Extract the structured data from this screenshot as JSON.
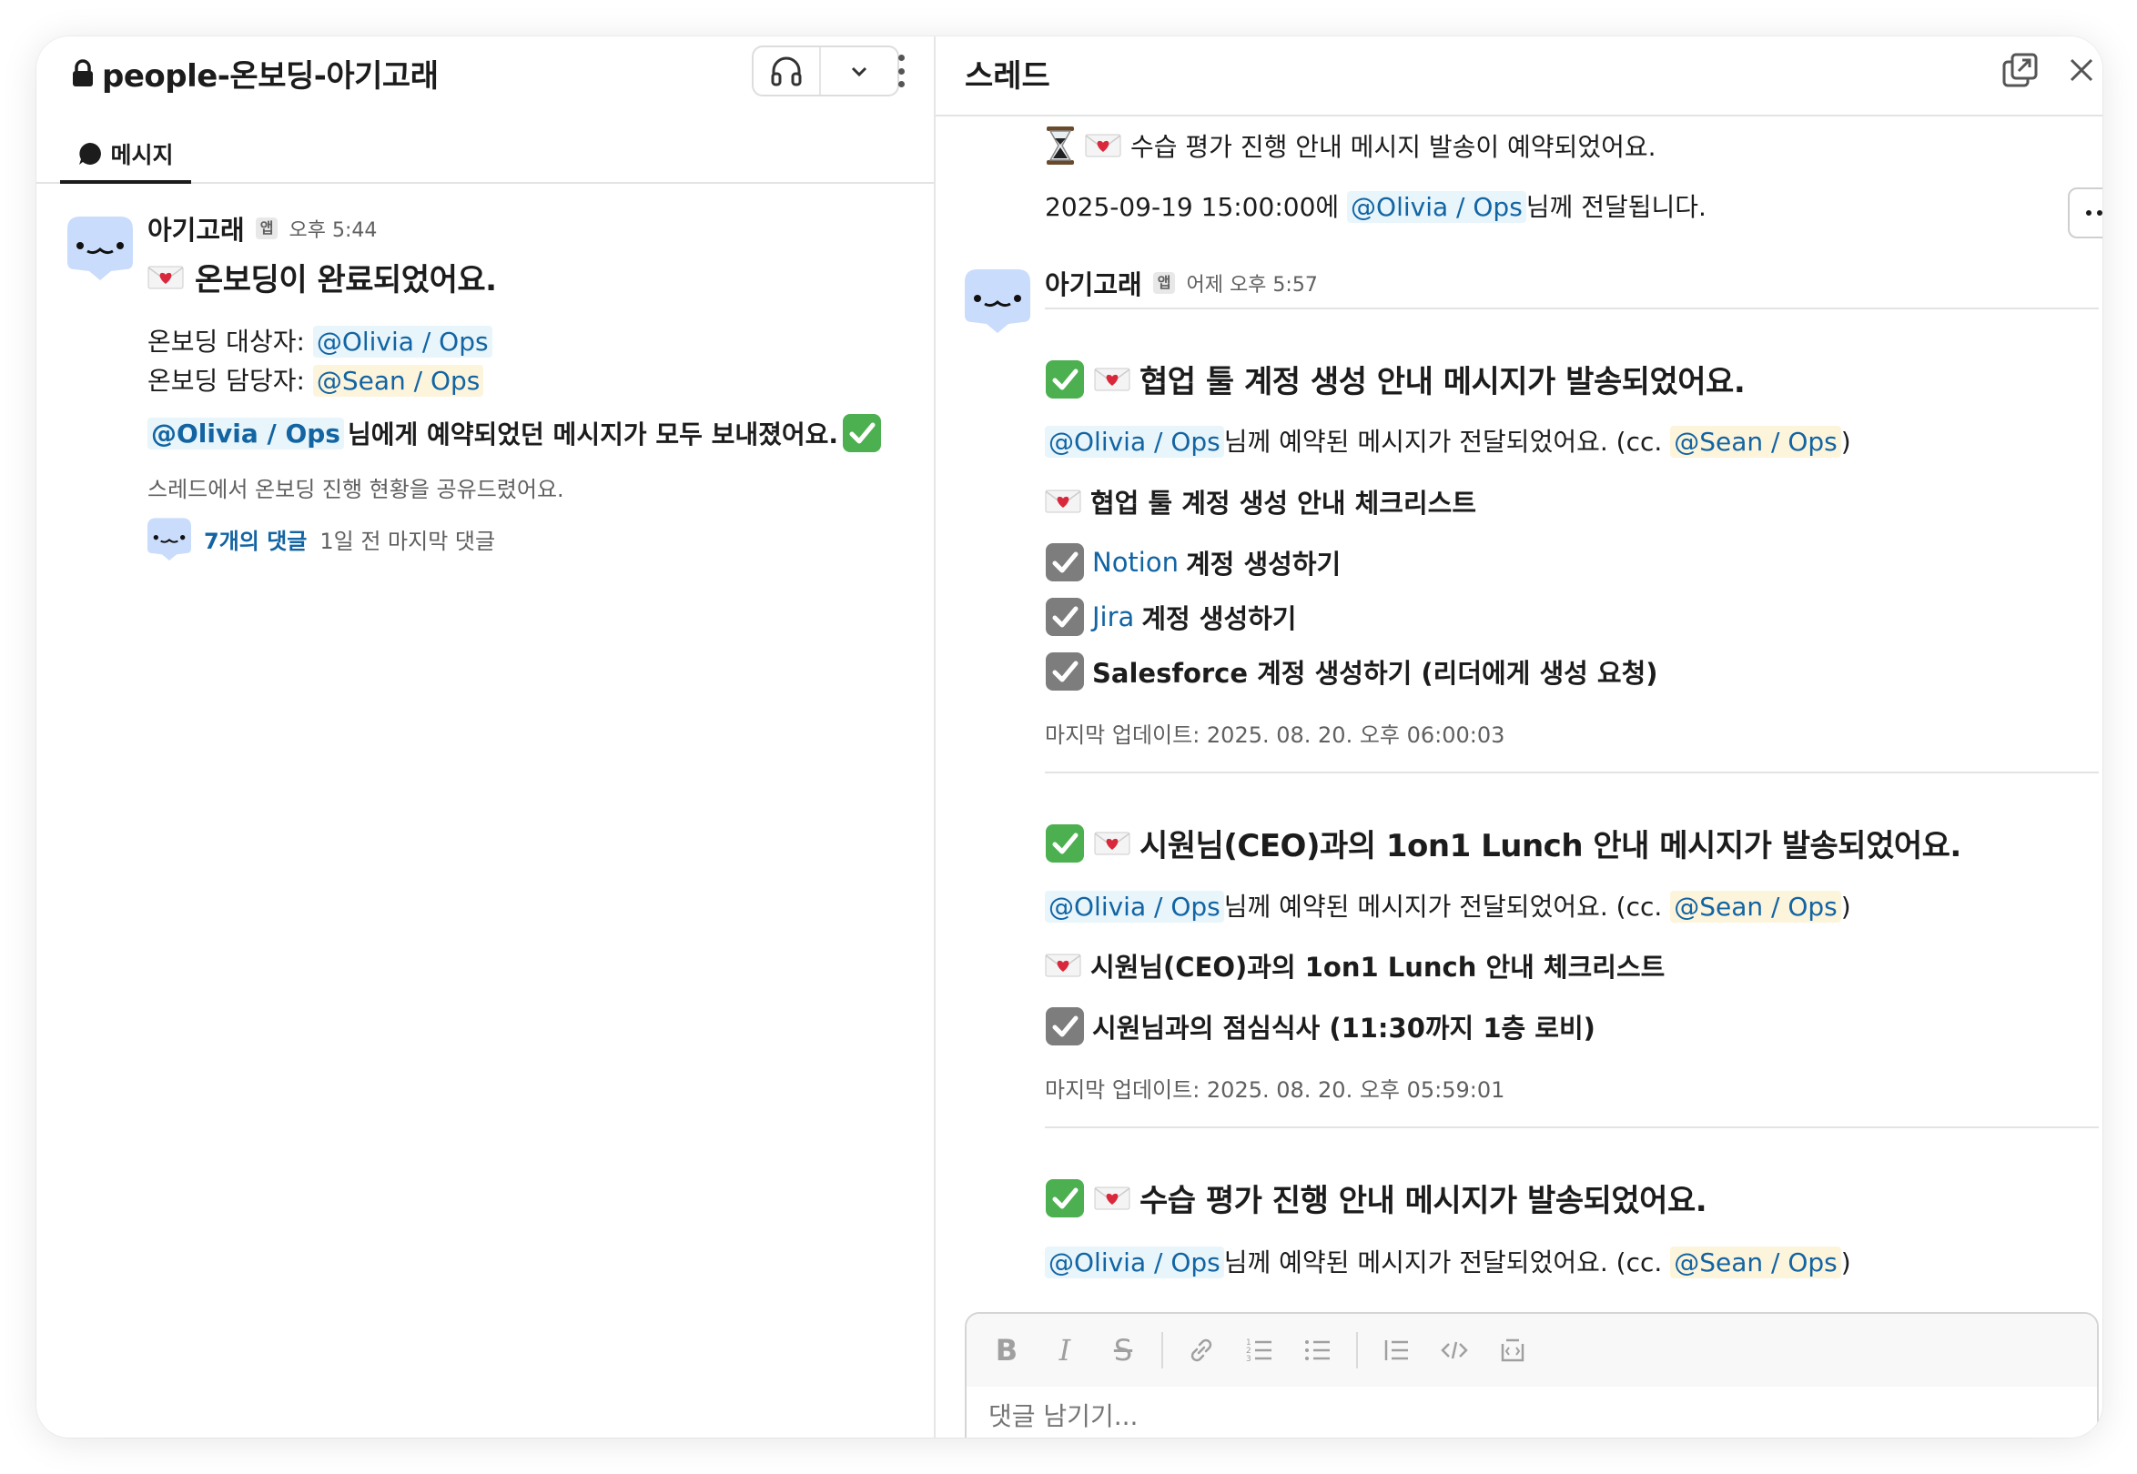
{
  "channel": {
    "name": "people-온보딩-아기고래",
    "tab_label": "메시지"
  },
  "left_message": {
    "sender": "아기고래",
    "badge": "앱",
    "time": "오후 5:44",
    "heading": "온보딩이 완료되었어요.",
    "target_label": "온보딩 대상자:",
    "target_mention": "@Olivia / Ops",
    "manager_label": "온보딩 담당자:",
    "manager_mention": "@Sean / Ops",
    "sent_mention": "@Olivia / Ops",
    "sent_text": "님에게 예약되었던 메시지가 모두 보내졌어요.",
    "note": "스레드에서 온보딩 진행 현황을 공유드렸어요.",
    "reply_count": "7개의 댓글",
    "reply_time": "1일 전 마지막 댓글"
  },
  "thread": {
    "title": "스레드",
    "top_line": "수습 평가 진행 안내 메시지 발송이 예약되었어요.",
    "schedule_date": "2025-09-19 15:00:00에",
    "schedule_mention": "@Olivia / Ops",
    "schedule_suffix": "님께 전달됩니다.",
    "sender": "아기고래",
    "badge": "앱",
    "time": "어제 오후 5:57",
    "cards": [
      {
        "heading": "협업 툴 계정 생성 안내 메시지가 발송되었어요.",
        "mention": "@Olivia / Ops",
        "delivered": "님께 예약된 메시지가 전달되었어요. (cc.",
        "cc_mention": "@Sean / Ops",
        "cc_close": ")",
        "list_title": "협업 툴 계정 생성 안내 체크리스트",
        "items": [
          {
            "link": "Notion",
            "text": "계정 생성하기"
          },
          {
            "link": "Jira",
            "text": "계정 생성하기"
          },
          {
            "link": "",
            "text": "Salesforce 계정 생성하기 (리더에게 생성 요청)"
          }
        ],
        "updated": "마지막 업데이트: 2025. 08. 20. 오후 06:00:03"
      },
      {
        "heading": "시원님(CEO)과의 1on1 Lunch 안내 메시지가 발송되었어요.",
        "mention": "@Olivia / Ops",
        "delivered": "님께 예약된 메시지가 전달되었어요. (cc.",
        "cc_mention": "@Sean / Ops",
        "cc_close": ")",
        "list_title": "시원님(CEO)과의 1on1 Lunch 안내 체크리스트",
        "items": [
          {
            "link": "",
            "text": "시원님과의 점심식사 (11:30까지 1층 로비)"
          }
        ],
        "updated": "마지막 업데이트: 2025. 08. 20. 오후 05:59:01"
      },
      {
        "heading": "수습 평가 진행 안내 메시지가 발송되었어요.",
        "mention": "@Olivia / Ops",
        "delivered": "님께 예약된 메시지가 전달되었어요. (cc.",
        "cc_mention": "@Sean / Ops",
        "cc_close": ")"
      }
    ]
  },
  "composer": {
    "placeholder": "댓글 남기기..."
  },
  "colors": {
    "mention_text": "#1264a3",
    "mention_bg": "#e8f5fa",
    "cc_bg": "#fdf4dc",
    "avatar": "#c9dcfb"
  }
}
